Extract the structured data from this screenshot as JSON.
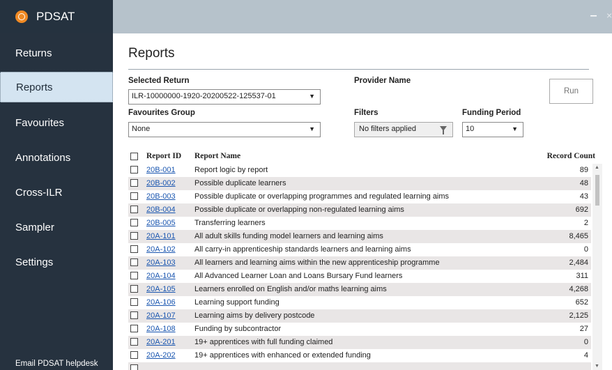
{
  "app": {
    "title": "PDSAT",
    "minimize": "‒",
    "close": "×"
  },
  "sidebar": {
    "items": [
      {
        "label": "Returns"
      },
      {
        "label": "Reports"
      },
      {
        "label": "Favourites"
      },
      {
        "label": "Annotations"
      },
      {
        "label": "Cross-ILR"
      },
      {
        "label": "Sampler"
      },
      {
        "label": "Settings"
      }
    ],
    "active": "Reports",
    "helpdesk": "Email PDSAT helpdesk"
  },
  "main": {
    "title": "Reports",
    "selected_return_label": "Selected Return",
    "selected_return_value": "ILR-10000000-1920-20200522-125537-01",
    "provider_name_label": "Provider Name",
    "favourites_group_label": "Favourites Group",
    "favourites_group_value": "None",
    "filters_label": "Filters",
    "filters_value": "No filters applied",
    "funding_period_label": "Funding Period",
    "funding_period_value": "10",
    "run_label": "Run"
  },
  "table": {
    "headers": {
      "id": "Report ID",
      "name": "Report Name",
      "count": "Record Count"
    },
    "rows": [
      {
        "id": "20B-001",
        "name": "Report logic by report",
        "count": "89"
      },
      {
        "id": "20B-002",
        "name": "Possible duplicate learners",
        "count": "48"
      },
      {
        "id": "20B-003",
        "name": "Possible duplicate or overlapping programmes and regulated learning aims",
        "count": "43"
      },
      {
        "id": "20B-004",
        "name": "Possible duplicate or overlapping non-regulated learning aims",
        "count": "692"
      },
      {
        "id": "20B-005",
        "name": "Transferring learners",
        "count": "2"
      },
      {
        "id": "20A-101",
        "name": "All adult skills funding model learners and learning aims",
        "count": "8,465"
      },
      {
        "id": "20A-102",
        "name": "All carry-in apprenticeship standards learners and learning aims",
        "count": "0"
      },
      {
        "id": "20A-103",
        "name": "All learners and learning aims within the new apprenticeship programme",
        "count": "2,484"
      },
      {
        "id": "20A-104",
        "name": "All Advanced Learner Loan and Loans Bursary Fund learners",
        "count": "311"
      },
      {
        "id": "20A-105",
        "name": "Learners enrolled on English and/or maths learning aims",
        "count": "4,268"
      },
      {
        "id": "20A-106",
        "name": "Learning support funding",
        "count": "652"
      },
      {
        "id": "20A-107",
        "name": "Learning aims by delivery postcode",
        "count": "2,125"
      },
      {
        "id": "20A-108",
        "name": "Funding by subcontractor",
        "count": "27"
      },
      {
        "id": "20A-201",
        "name": "19+ apprentices with full funding claimed",
        "count": "0"
      },
      {
        "id": "20A-202",
        "name": "19+ apprentices with enhanced or extended funding",
        "count": "4"
      },
      {
        "id": "",
        "name": "",
        "count": ""
      }
    ]
  },
  "colors": {
    "sidebar_bg": "#26323f",
    "titlebar_bg": "#b6c2cb",
    "active_nav_bg": "#d4e4f1",
    "link": "#1a56b0",
    "logo": "#f08a24",
    "row_alt": "#e9e6e6"
  },
  "icons": [
    "app-logo-icon",
    "chevron-down-icon",
    "filter-icon",
    "minimize-icon",
    "close-icon"
  ]
}
